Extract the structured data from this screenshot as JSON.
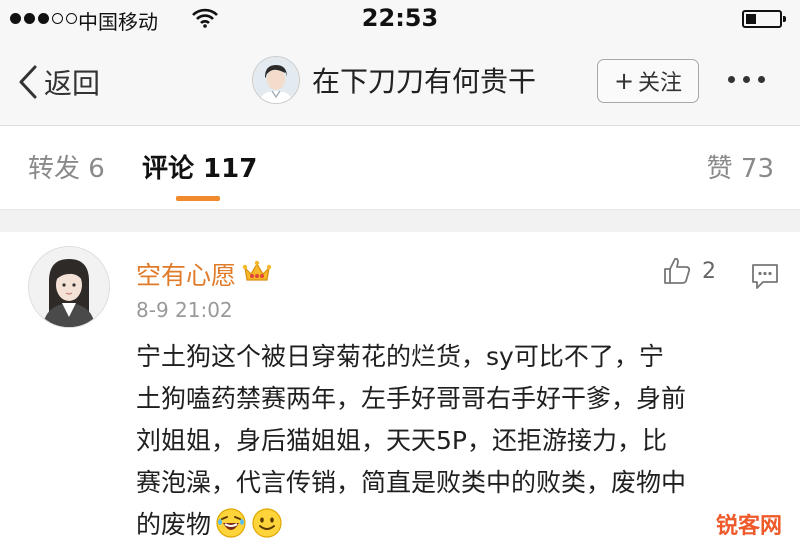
{
  "status_bar": {
    "carrier": "中国移动",
    "time": "22:53",
    "signal_bars_filled": 3,
    "signal_bars_total": 5,
    "battery_level": 0.3
  },
  "nav": {
    "back_label": "返回",
    "title": "在下刀刀有何贵干",
    "follow_label": "关注",
    "follow_plus": "+"
  },
  "tabs": {
    "repost": "转发 6",
    "comment": "评论 117",
    "like": "赞 73",
    "active": "comment",
    "accent": "#f08a2c"
  },
  "comment": {
    "user": "空有心愿",
    "user_color": "#e07b2a",
    "badge_icon": "crown-icon",
    "time": "8-9 21:02",
    "likes": "2",
    "lines": [
      "宁土狗这个被日穿菊花的烂货，sy可比不了，宁",
      "土狗嗑药禁赛两年，左手好哥哥右手好干爹，身前",
      "刘姐姐，身后猫姐姐，天天5P，还拒游接力，比",
      "赛泡澡，代言传销，简直是败类中的败类，废物中",
      "的废物"
    ],
    "emojis": [
      "laughing-emoji",
      "smile-emoji"
    ]
  },
  "watermark": "锐客网"
}
